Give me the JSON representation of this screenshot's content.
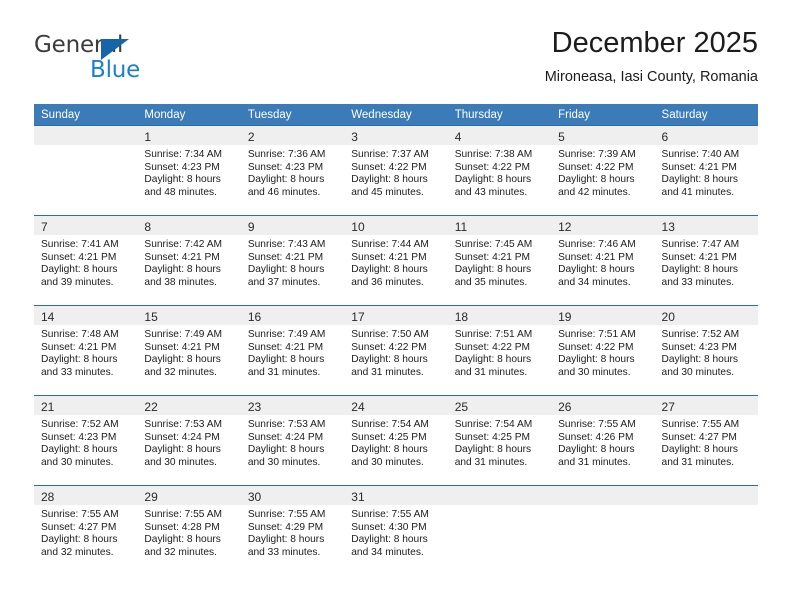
{
  "brand": {
    "name_top": "General",
    "name_bottom": "Blue",
    "triangle_color": "#1565a8",
    "blue_color": "#1a7fd4"
  },
  "header": {
    "title": "December 2025",
    "subtitle": "Mironeasa, Iasi County, Romania"
  },
  "theme": {
    "header_row_bg": "#3b7cb8",
    "row_divider": "#2c6ca8",
    "date_band_bg": "#efefef"
  },
  "weekday_headers": [
    "Sunday",
    "Monday",
    "Tuesday",
    "Wednesday",
    "Thursday",
    "Friday",
    "Saturday"
  ],
  "weeks": [
    [
      {
        "date": "",
        "lines": []
      },
      {
        "date": "1",
        "lines": [
          "Sunrise: 7:34 AM",
          "Sunset: 4:23 PM",
          "Daylight: 8 hours",
          "and 48 minutes."
        ]
      },
      {
        "date": "2",
        "lines": [
          "Sunrise: 7:36 AM",
          "Sunset: 4:23 PM",
          "Daylight: 8 hours",
          "and 46 minutes."
        ]
      },
      {
        "date": "3",
        "lines": [
          "Sunrise: 7:37 AM",
          "Sunset: 4:22 PM",
          "Daylight: 8 hours",
          "and 45 minutes."
        ]
      },
      {
        "date": "4",
        "lines": [
          "Sunrise: 7:38 AM",
          "Sunset: 4:22 PM",
          "Daylight: 8 hours",
          "and 43 minutes."
        ]
      },
      {
        "date": "5",
        "lines": [
          "Sunrise: 7:39 AM",
          "Sunset: 4:22 PM",
          "Daylight: 8 hours",
          "and 42 minutes."
        ]
      },
      {
        "date": "6",
        "lines": [
          "Sunrise: 7:40 AM",
          "Sunset: 4:21 PM",
          "Daylight: 8 hours",
          "and 41 minutes."
        ]
      }
    ],
    [
      {
        "date": "7",
        "lines": [
          "Sunrise: 7:41 AM",
          "Sunset: 4:21 PM",
          "Daylight: 8 hours",
          "and 39 minutes."
        ]
      },
      {
        "date": "8",
        "lines": [
          "Sunrise: 7:42 AM",
          "Sunset: 4:21 PM",
          "Daylight: 8 hours",
          "and 38 minutes."
        ]
      },
      {
        "date": "9",
        "lines": [
          "Sunrise: 7:43 AM",
          "Sunset: 4:21 PM",
          "Daylight: 8 hours",
          "and 37 minutes."
        ]
      },
      {
        "date": "10",
        "lines": [
          "Sunrise: 7:44 AM",
          "Sunset: 4:21 PM",
          "Daylight: 8 hours",
          "and 36 minutes."
        ]
      },
      {
        "date": "11",
        "lines": [
          "Sunrise: 7:45 AM",
          "Sunset: 4:21 PM",
          "Daylight: 8 hours",
          "and 35 minutes."
        ]
      },
      {
        "date": "12",
        "lines": [
          "Sunrise: 7:46 AM",
          "Sunset: 4:21 PM",
          "Daylight: 8 hours",
          "and 34 minutes."
        ]
      },
      {
        "date": "13",
        "lines": [
          "Sunrise: 7:47 AM",
          "Sunset: 4:21 PM",
          "Daylight: 8 hours",
          "and 33 minutes."
        ]
      }
    ],
    [
      {
        "date": "14",
        "lines": [
          "Sunrise: 7:48 AM",
          "Sunset: 4:21 PM",
          "Daylight: 8 hours",
          "and 33 minutes."
        ]
      },
      {
        "date": "15",
        "lines": [
          "Sunrise: 7:49 AM",
          "Sunset: 4:21 PM",
          "Daylight: 8 hours",
          "and 32 minutes."
        ]
      },
      {
        "date": "16",
        "lines": [
          "Sunrise: 7:49 AM",
          "Sunset: 4:21 PM",
          "Daylight: 8 hours",
          "and 31 minutes."
        ]
      },
      {
        "date": "17",
        "lines": [
          "Sunrise: 7:50 AM",
          "Sunset: 4:22 PM",
          "Daylight: 8 hours",
          "and 31 minutes."
        ]
      },
      {
        "date": "18",
        "lines": [
          "Sunrise: 7:51 AM",
          "Sunset: 4:22 PM",
          "Daylight: 8 hours",
          "and 31 minutes."
        ]
      },
      {
        "date": "19",
        "lines": [
          "Sunrise: 7:51 AM",
          "Sunset: 4:22 PM",
          "Daylight: 8 hours",
          "and 30 minutes."
        ]
      },
      {
        "date": "20",
        "lines": [
          "Sunrise: 7:52 AM",
          "Sunset: 4:23 PM",
          "Daylight: 8 hours",
          "and 30 minutes."
        ]
      }
    ],
    [
      {
        "date": "21",
        "lines": [
          "Sunrise: 7:52 AM",
          "Sunset: 4:23 PM",
          "Daylight: 8 hours",
          "and 30 minutes."
        ]
      },
      {
        "date": "22",
        "lines": [
          "Sunrise: 7:53 AM",
          "Sunset: 4:24 PM",
          "Daylight: 8 hours",
          "and 30 minutes."
        ]
      },
      {
        "date": "23",
        "lines": [
          "Sunrise: 7:53 AM",
          "Sunset: 4:24 PM",
          "Daylight: 8 hours",
          "and 30 minutes."
        ]
      },
      {
        "date": "24",
        "lines": [
          "Sunrise: 7:54 AM",
          "Sunset: 4:25 PM",
          "Daylight: 8 hours",
          "and 30 minutes."
        ]
      },
      {
        "date": "25",
        "lines": [
          "Sunrise: 7:54 AM",
          "Sunset: 4:25 PM",
          "Daylight: 8 hours",
          "and 31 minutes."
        ]
      },
      {
        "date": "26",
        "lines": [
          "Sunrise: 7:55 AM",
          "Sunset: 4:26 PM",
          "Daylight: 8 hours",
          "and 31 minutes."
        ]
      },
      {
        "date": "27",
        "lines": [
          "Sunrise: 7:55 AM",
          "Sunset: 4:27 PM",
          "Daylight: 8 hours",
          "and 31 minutes."
        ]
      }
    ],
    [
      {
        "date": "28",
        "lines": [
          "Sunrise: 7:55 AM",
          "Sunset: 4:27 PM",
          "Daylight: 8 hours",
          "and 32 minutes."
        ]
      },
      {
        "date": "29",
        "lines": [
          "Sunrise: 7:55 AM",
          "Sunset: 4:28 PM",
          "Daylight: 8 hours",
          "and 32 minutes."
        ]
      },
      {
        "date": "30",
        "lines": [
          "Sunrise: 7:55 AM",
          "Sunset: 4:29 PM",
          "Daylight: 8 hours",
          "and 33 minutes."
        ]
      },
      {
        "date": "31",
        "lines": [
          "Sunrise: 7:55 AM",
          "Sunset: 4:30 PM",
          "Daylight: 8 hours",
          "and 34 minutes."
        ]
      },
      {
        "date": "",
        "lines": []
      },
      {
        "date": "",
        "lines": []
      },
      {
        "date": "",
        "lines": []
      }
    ]
  ]
}
